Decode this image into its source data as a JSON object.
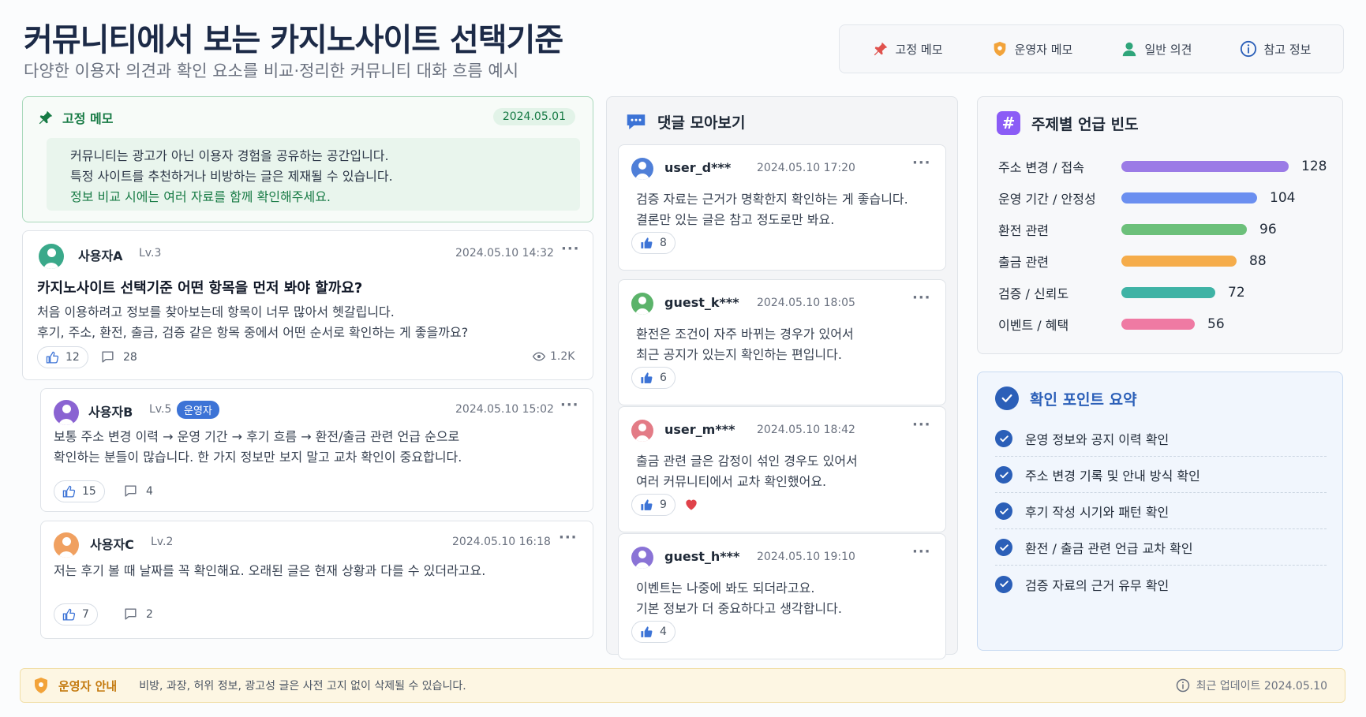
{
  "header": {
    "title": "커뮤니티에서 보는 카지노사이트 선택기준",
    "subtitle": "다양한 이용자 의견과 확인 요소를 비교·정리한 커뮤니티 대화 흐름 예시"
  },
  "legend": {
    "pinned": "고정 메모",
    "operator": "운영자 메모",
    "general": "일반 의견",
    "reference": "참고 정보"
  },
  "pinned": {
    "label": "고정 메모",
    "date": "2024.05.01",
    "line1": "커뮤니티는 광고가 아닌 이용자 경험을 공유하는 공간입니다.",
    "line2": "특정 사이트를 추천하거나 비방하는 글은 제재될 수 있습니다.",
    "line3": "정보 비교 시에는 여러 자료를 함께 확인해주세요."
  },
  "post": {
    "user": "사용자A",
    "level": "Lv.3",
    "time": "2024.05.10 14:32",
    "title": "카지노사이트 선택기준 어떤 항목을 먼저 봐야 할까요?",
    "line1": "처음 이용하려고 정보를 찾아보는데 항목이 너무 많아서 헷갈립니다.",
    "line2": "후기, 주소, 환전, 출금, 검증 같은 항목 중에서 어떤 순서로 확인하는 게 좋을까요?",
    "likes": "12",
    "comments": "28",
    "views": "1.2K"
  },
  "reply1": {
    "user": "사용자B",
    "level": "Lv.5",
    "badge": "운영자",
    "time": "2024.05.10 15:02",
    "line1": "보통 주소 변경 이력 → 운영 기간 → 후기 흐름 → 환전/출금 관련 언급 순으로",
    "line2": "확인하는 분들이 많습니다. 한 가지 정보만 보지 말고 교차 확인이 중요합니다.",
    "likes": "15",
    "comments": "4"
  },
  "reply2": {
    "user": "사용자C",
    "level": "Lv.2",
    "time": "2024.05.10 16:18",
    "line1": "저는 후기 볼 때 날짜를 꼭 확인해요.  오래된 글은 현재 상황과 다를 수 있더라고요.",
    "likes": "7",
    "comments": "2"
  },
  "comments_panel": {
    "title": "댓글 모아보기",
    "items": [
      {
        "user": "user_d***",
        "time": "2024.05.10 17:20",
        "line1": "검증 자료는 근거가 명확한지 확인하는 게 좋습니다.",
        "line2": "결론만 있는 글은 참고 정도로만 봐요.",
        "likes": "8",
        "avatar_color": "#4f7fd8"
      },
      {
        "user": "guest_k***",
        "time": "2024.05.10 18:05",
        "line1": "환전은 조건이 자주 바뀌는 경우가 있어서",
        "line2": "최근 공지가 있는지 확인하는 편입니다.",
        "likes": "6",
        "avatar_color": "#5bb36a"
      },
      {
        "user": "user_m***",
        "time": "2024.05.10 18:42",
        "line1": "출금 관련 글은 감정이 섞인 경우도 있어서",
        "line2": "여러 커뮤니티에서 교차 확인했어요.",
        "likes": "9",
        "avatar_color": "#e37b86"
      },
      {
        "user": "guest_h***",
        "time": "2024.05.10 19:10",
        "line1": "이벤트는 나중에 봐도 되더라고요.",
        "line2": "기본 정보가 더 중요하다고 생각합니다.",
        "likes": "4",
        "avatar_color": "#8a73d6"
      }
    ]
  },
  "frequency": {
    "title": "주제별 언급 빈도",
    "max": 128,
    "rows": [
      {
        "label": "주소 변경 / 접속",
        "value": 128,
        "color": "#9b7be6"
      },
      {
        "label": "운영 기간 / 안정성",
        "value": 104,
        "color": "#6b8ff0"
      },
      {
        "label": "환전 관련",
        "value": 96,
        "color": "#6cc07a"
      },
      {
        "label": "출금 관련",
        "value": 88,
        "color": "#f5ac4a"
      },
      {
        "label": "검증 / 신뢰도",
        "value": 72,
        "color": "#3fb3a5"
      },
      {
        "label": "이벤트 / 혜택",
        "value": 56,
        "color": "#ef7aa3"
      }
    ]
  },
  "checkpoints": {
    "title": "확인 포인트 요약",
    "items": [
      "운영 정보와 공지 이력 확인",
      "주소 변경 기록 및 안내 방식 확인",
      "후기 작성 시기와 패턴 확인",
      "환전 / 출금 관련 언급 교차 확인",
      "검증 자료의 근거 유무 확인"
    ]
  },
  "footer": {
    "title": "운영자 안내",
    "text": "비방, 과장, 허위 정보, 광고성 글은 사전 고지 없이 삭제될 수 있습니다.",
    "update": "최근 업데이트 2024.05.10"
  }
}
